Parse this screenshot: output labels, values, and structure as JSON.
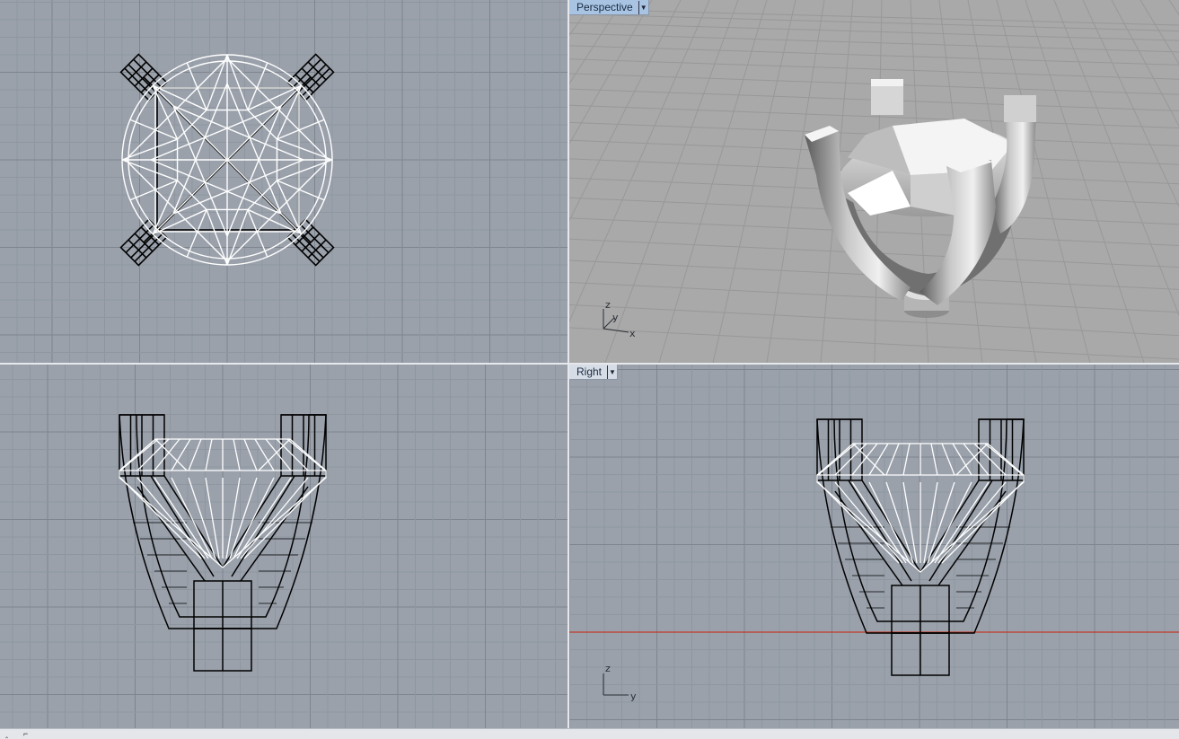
{
  "viewports": {
    "top_left": {
      "label": ""
    },
    "perspective": {
      "label": "Perspective",
      "axes": {
        "z": "z",
        "y": "y",
        "x": "x"
      }
    },
    "bottom_left": {
      "label": ""
    },
    "right": {
      "label": "Right",
      "axes": {
        "z": "z",
        "y": "y"
      }
    }
  },
  "colors": {
    "viewport_bg": "#9aa1ab",
    "perspective_bg": "#a9a9a9",
    "grid_minor": "#8e959f",
    "grid_major": "#7d848e",
    "wire_curve": "#000000",
    "wire_gem": "#ffffff",
    "axis_red": "#c0392b",
    "active_tab": "#a8c4e2"
  },
  "icons": {
    "tab_dropdown": "chevron-down-icon"
  },
  "statusbar": {
    "marks": [
      "‸",
      "⌐"
    ]
  }
}
